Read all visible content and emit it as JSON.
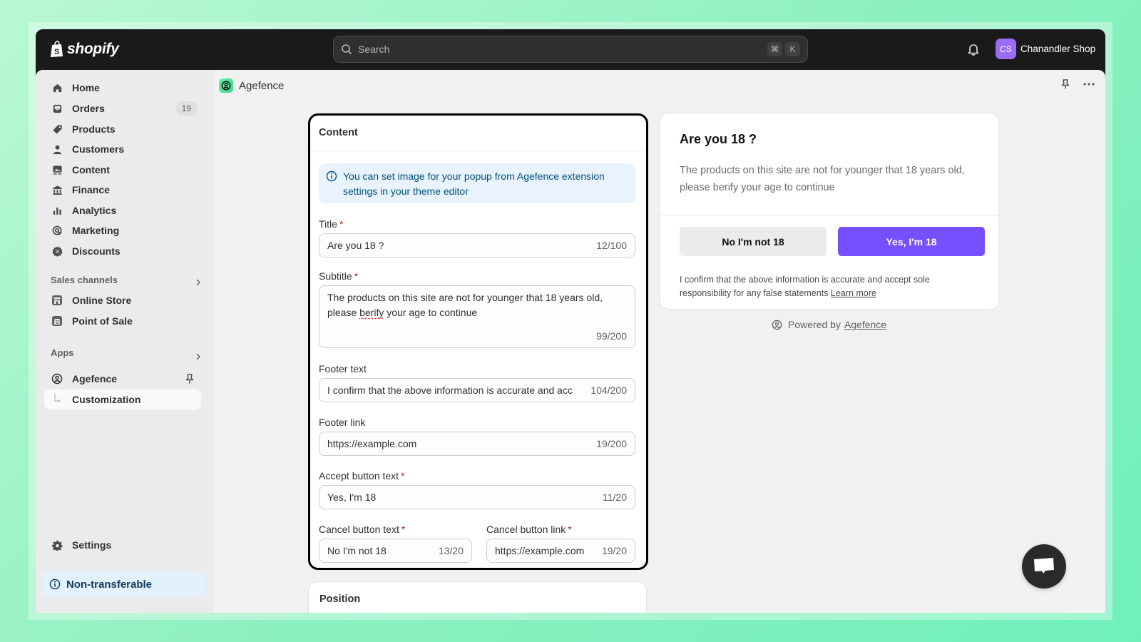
{
  "topbar": {
    "brand": "shopify",
    "search_placeholder": "Search",
    "shortcut_keys": [
      "⌘",
      "K"
    ],
    "account_initials": "CS",
    "account_name": "Chanandler Shop",
    "avatar_color": "#9b6cf6"
  },
  "sidebar": {
    "items": [
      {
        "label": "Home",
        "icon": "home-icon"
      },
      {
        "label": "Orders",
        "icon": "inbox-icon",
        "badge": "19"
      },
      {
        "label": "Products",
        "icon": "tag-icon"
      },
      {
        "label": "Customers",
        "icon": "person-icon"
      },
      {
        "label": "Content",
        "icon": "image-icon"
      },
      {
        "label": "Finance",
        "icon": "bank-icon"
      },
      {
        "label": "Analytics",
        "icon": "bar-chart-icon"
      },
      {
        "label": "Marketing",
        "icon": "target-icon"
      },
      {
        "label": "Discounts",
        "icon": "discount-icon"
      }
    ],
    "sales_channels": {
      "heading": "Sales channels",
      "items": [
        {
          "label": "Online Store",
          "icon": "store-icon"
        },
        {
          "label": "Point of Sale",
          "icon": "pos-icon"
        }
      ]
    },
    "apps": {
      "heading": "Apps",
      "items": [
        {
          "label": "Agefence",
          "icon": "agefence-icon"
        },
        {
          "label": "Customization",
          "active": true
        }
      ]
    },
    "settings_label": "Settings",
    "plan_label": "Non-transferable"
  },
  "page": {
    "title": "Agefence"
  },
  "content_form": {
    "heading": "Content",
    "banner": "You can set image for your popup from Agefence extension settings in your theme editor",
    "fields": {
      "title": {
        "label": "Title",
        "required": true,
        "value": "Are you 18 ?",
        "count": "12/100"
      },
      "subtitle": {
        "label": "Subtitle",
        "required": true,
        "value_pre": "The products on this site are not for younger that 18 years old, please ",
        "value_misspelled": "berify",
        "value_post": " your age to continue",
        "count": "99/200"
      },
      "footer_text": {
        "label": "Footer text",
        "required": false,
        "value": "I confirm that the above information is accurate and acc",
        "count": "104/200"
      },
      "footer_link": {
        "label": "Footer link",
        "required": false,
        "value": "https://example.com",
        "count": "19/200"
      },
      "accept_button": {
        "label": "Accept button text",
        "required": true,
        "value": "Yes, I'm 18",
        "count": "11/20"
      },
      "cancel_button": {
        "label": "Cancel button text",
        "required": true,
        "value": "No I'm not 18",
        "count": "13/20"
      },
      "cancel_link": {
        "label": "Cancel button link",
        "required": true,
        "value": "https://example.com",
        "count": "19/20"
      }
    },
    "required_mark": "*"
  },
  "position_card": {
    "heading": "Position"
  },
  "preview": {
    "title": "Are you 18 ?",
    "subtitle": "The products on this site are not for younger that 18 years old, please berify your age to continue",
    "cancel_label": "No I'm not 18",
    "accept_label": "Yes, I'm 18",
    "accept_color": "#7650ff",
    "footer": "I confirm that the above information is accurate and accept sole responsibility for any false statements",
    "footer_link": "Learn more",
    "powered_by": "Powered by",
    "powered_link": "Agefence"
  }
}
